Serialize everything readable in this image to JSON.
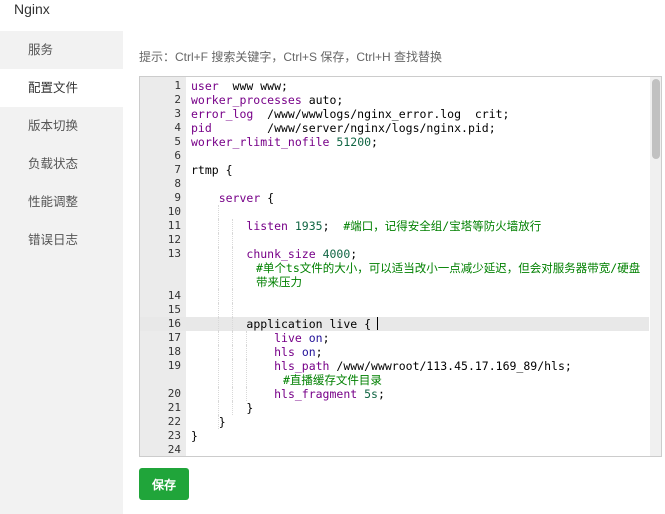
{
  "window": {
    "title": "Nginx"
  },
  "sidebar": {
    "items": [
      {
        "label": "服务"
      },
      {
        "label": "配置文件",
        "active": true
      },
      {
        "label": "版本切换"
      },
      {
        "label": "负载状态"
      },
      {
        "label": "性能调整"
      },
      {
        "label": "错误日志"
      }
    ]
  },
  "tip": "提示：Ctrl+F 搜索关键字，Ctrl+S 保存，Ctrl+H 查找替换",
  "editor": {
    "line_numbers": [
      "1",
      "2",
      "3",
      "4",
      "5",
      "6",
      "7",
      "8",
      "9",
      "10",
      "11",
      "12",
      "13",
      "14",
      "15",
      "16",
      "17",
      "18",
      "19",
      "20",
      "21",
      "22",
      "23",
      "24"
    ],
    "code": {
      "l1": {
        "kw": "user",
        "rest": "  www www;"
      },
      "l2": {
        "kw": "worker_processes",
        "rest": " auto;"
      },
      "l3": {
        "kw": "error_log",
        "rest": "  /www/wwwlogs/nginx_error.log  crit;"
      },
      "l4": {
        "kw": "pid",
        "rest": "        /www/server/nginx/logs/nginx.pid;"
      },
      "l5": {
        "kw": "worker_rlimit_nofile",
        "num": "51200",
        "semi": ";"
      },
      "l7": {
        "text": "rtmp {"
      },
      "l9": {
        "kw": "server",
        "rest": " {"
      },
      "l11": {
        "kw": "listen",
        "num": "1935",
        "semi": ";",
        "comment": "#端口，记得安全组/宝塔等防火墙放行"
      },
      "l13": {
        "kw": "chunk_size",
        "num": "4000",
        "semi": ";",
        "comment": "#单个ts文件的大小，可以适当改小一点减少延迟，但会对服务器带宽/硬盘带来压力"
      },
      "l16": {
        "text": "application live {"
      },
      "l17": {
        "kw": "live",
        "atom": "on",
        "semi": ";"
      },
      "l18": {
        "kw": "hls",
        "atom": "on",
        "semi": ";"
      },
      "l19": {
        "kw": "hls_path",
        "rest": " /www/wwwroot/113.45.17.169_89/hls;",
        "comment": "#直播缓存文件目录"
      },
      "l20": {
        "kw": "hls_fragment",
        "num": "5s",
        "semi": ";"
      },
      "l21": {
        "text": "}"
      },
      "l22": {
        "text": "}"
      },
      "l23": {
        "text": "}"
      }
    }
  },
  "buttons": {
    "save": "保存"
  },
  "colors": {
    "accent": "#20a53a",
    "keyword": "#770088",
    "number": "#116644",
    "atom": "#221199",
    "comment": "#008000"
  }
}
